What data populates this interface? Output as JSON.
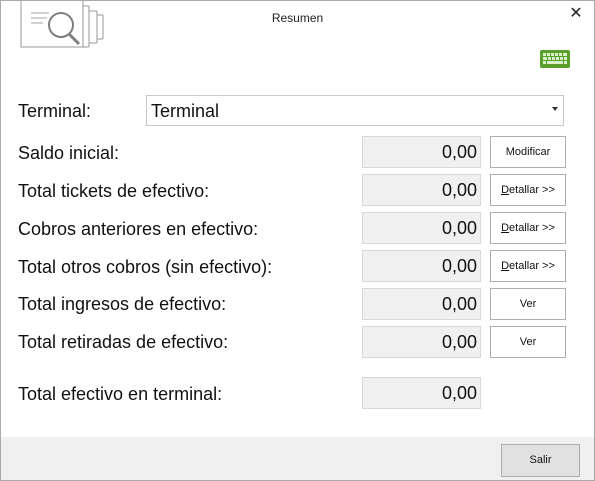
{
  "window": {
    "title": "Resumen",
    "close_glyph": "✕"
  },
  "icons": {
    "app": "magnifier-documents-icon",
    "keyboard": "keyboard-icon",
    "keyboard_color": "#5aa02c"
  },
  "terminal": {
    "label": "Terminal:",
    "selected": "Terminal"
  },
  "rows": [
    {
      "label": "Saldo inicial:",
      "value": "0,00",
      "button": "Modificar"
    },
    {
      "label": "Total tickets de efectivo:",
      "value": "0,00",
      "button": "Detallar >>",
      "button_mnemonic": "D",
      "button_rest": "etallar >>"
    },
    {
      "label": "Cobros anteriores en efectivo:",
      "value": "0,00",
      "button": "Detallar >>",
      "button_mnemonic": "D",
      "button_rest": "etallar >>"
    },
    {
      "label": "Total otros cobros (sin efectivo):",
      "value": "0,00",
      "button": "Detallar >>",
      "button_mnemonic": "D",
      "button_rest": "etallar >>"
    },
    {
      "label": "Total ingresos de efectivo:",
      "value": "0,00",
      "button": "Ver"
    },
    {
      "label": "Total retiradas de efectivo:",
      "value": "0,00",
      "button": "Ver"
    }
  ],
  "total": {
    "label": "Total efectivo en terminal:",
    "value": "0,00"
  },
  "footer": {
    "exit_label": "Salir"
  }
}
